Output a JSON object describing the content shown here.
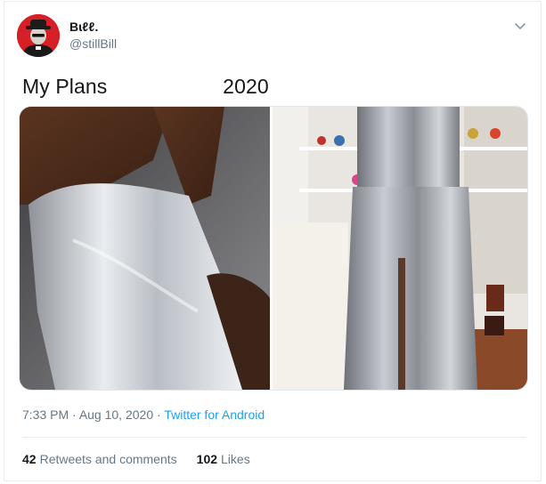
{
  "user": {
    "display_name": "Bɩℓℓ.",
    "handle": "@stillBill",
    "avatar_icon": "avatar-image"
  },
  "tweet": {
    "text": "My Plans                    2020"
  },
  "media": {
    "left_alt": "",
    "right_alt": ""
  },
  "meta": {
    "time": "7:33 PM",
    "sep1": " · ",
    "date": "Aug 10, 2020",
    "sep2": " · ",
    "source": "Twitter for Android"
  },
  "stats": {
    "retweets_count": "42",
    "retweets_label": "Retweets and comments",
    "likes_count": "102",
    "likes_label": "Likes"
  },
  "colors": {
    "link": "#1da1f2",
    "muted": "#657786",
    "text": "#14171a",
    "avatar_bg": "#d61f26"
  },
  "icons": {
    "menu": "chevron-down-icon"
  }
}
